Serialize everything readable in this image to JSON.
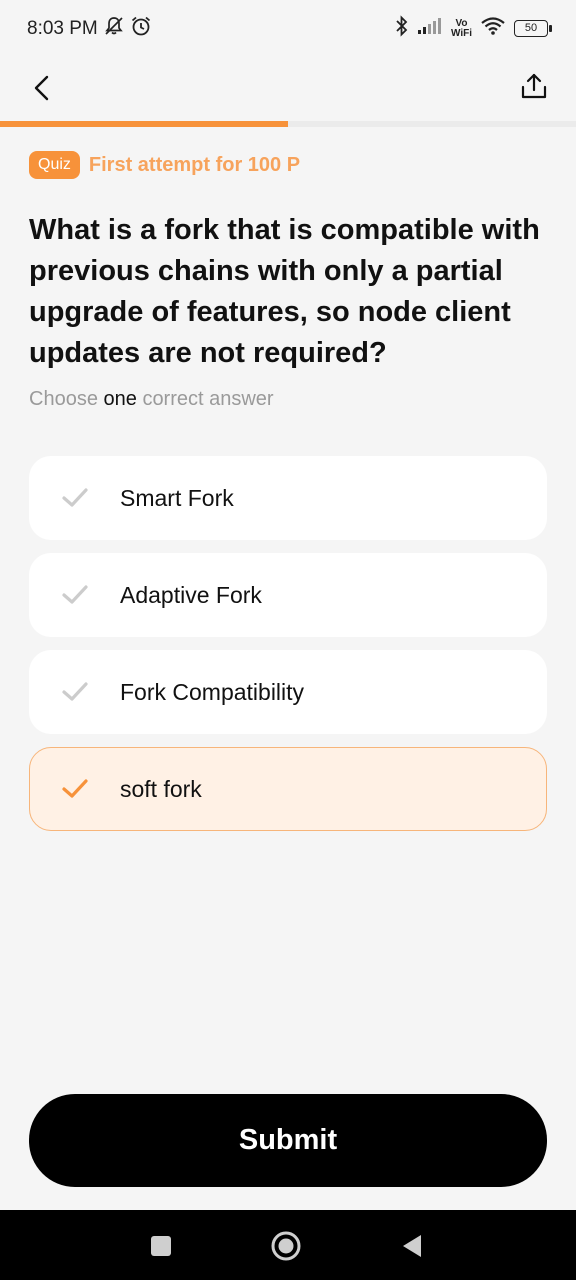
{
  "status_bar": {
    "time": "8:03 PM",
    "icons_left": [
      "mute-icon",
      "alarm-icon"
    ],
    "icons_right": [
      "bluetooth-icon",
      "signal-icon",
      "vowifi-icon",
      "wifi-icon",
      "battery-icon"
    ],
    "vowifi_top": "Vo",
    "vowifi_bottom": "WiFi",
    "battery_level": "50"
  },
  "header": {
    "back_icon": "chevron-left-icon",
    "share_icon": "share-icon"
  },
  "progress": {
    "fraction": 0.5,
    "color": "#f7923a"
  },
  "quiz": {
    "badge": "Quiz",
    "reward": "First attempt for 100 P",
    "question": "What is a fork that is compatible with previous chains with only a partial upgrade of features, so node client updates are not required?",
    "instruction_prefix": "Choose",
    "instruction_emphasis": "one",
    "instruction_suffix": "correct answer"
  },
  "options": [
    {
      "label": "Smart Fork",
      "selected": false
    },
    {
      "label": "Adaptive Fork",
      "selected": false
    },
    {
      "label": "Fork Compatibility",
      "selected": false
    },
    {
      "label": "soft fork",
      "selected": true
    }
  ],
  "submit_label": "Submit",
  "colors": {
    "accent": "#f7923a",
    "accent_soft": "#fff1e5",
    "check_inactive": "#cccccc",
    "background": "#f5f5f5"
  },
  "nav_bar": {
    "icons": [
      "recents-square-icon",
      "home-circle-icon",
      "back-triangle-icon"
    ]
  }
}
